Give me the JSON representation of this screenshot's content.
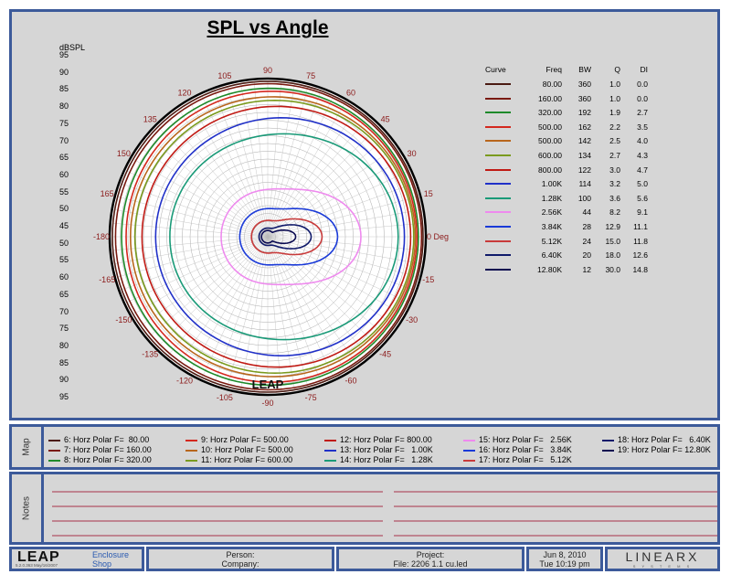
{
  "title": "SPL vs Angle",
  "y_axis_title": "dBSPL",
  "y_axis_labels": [
    "95",
    "90",
    "85",
    "80",
    "75",
    "70",
    "65",
    "60",
    "55",
    "50",
    "45",
    "50",
    "55",
    "60",
    "65",
    "70",
    "75",
    "80",
    "85",
    "90",
    "95"
  ],
  "angle_labels": [
    {
      "text": "90",
      "angle": 90
    },
    {
      "text": "75",
      "angle": 75
    },
    {
      "text": "60",
      "angle": 60
    },
    {
      "text": "45",
      "angle": 45
    },
    {
      "text": "30",
      "angle": 30
    },
    {
      "text": "15",
      "angle": 15
    },
    {
      "text": "0 Deg",
      "angle": 0
    },
    {
      "text": "-15",
      "angle": -15
    },
    {
      "text": "-30",
      "angle": -30
    },
    {
      "text": "-45",
      "angle": -45
    },
    {
      "text": "-60",
      "angle": -60
    },
    {
      "text": "-75",
      "angle": -75
    },
    {
      "text": "-90",
      "angle": -90
    },
    {
      "text": "-105",
      "angle": -105
    },
    {
      "text": "-120",
      "angle": -120
    },
    {
      "text": "-135",
      "angle": -135
    },
    {
      "text": "-150",
      "angle": -150
    },
    {
      "text": "-165",
      "angle": -165
    },
    {
      "text": "-180",
      "angle": 180
    },
    {
      "text": "165",
      "angle": 165
    },
    {
      "text": "150",
      "angle": 150
    },
    {
      "text": "135",
      "angle": 135
    },
    {
      "text": "120",
      "angle": 120
    },
    {
      "text": "105",
      "angle": 105
    }
  ],
  "curve_table": {
    "headers": [
      "Curve",
      "Freq",
      "BW",
      "Q",
      "DI"
    ],
    "rows": [
      {
        "color": "#4b1a12",
        "freq": "80.00",
        "bw": "360",
        "q": "1.0",
        "di": "0.0"
      },
      {
        "color": "#7a1a10",
        "freq": "160.00",
        "bw": "360",
        "q": "1.0",
        "di": "0.0"
      },
      {
        "color": "#1e8a2a",
        "freq": "320.00",
        "bw": "192",
        "q": "1.9",
        "di": "2.7"
      },
      {
        "color": "#d4281e",
        "freq": "500.00",
        "bw": "162",
        "q": "2.2",
        "di": "3.5"
      },
      {
        "color": "#b8661c",
        "freq": "500.00",
        "bw": "142",
        "q": "2.5",
        "di": "4.0"
      },
      {
        "color": "#7a9a1e",
        "freq": "600.00",
        "bw": "134",
        "q": "2.7",
        "di": "4.3"
      },
      {
        "color": "#c01a14",
        "freq": "800.00",
        "bw": "122",
        "q": "3.0",
        "di": "4.7"
      },
      {
        "color": "#2030c8",
        "freq": "1.00K",
        "bw": "114",
        "q": "3.2",
        "di": "5.0"
      },
      {
        "color": "#1a9a78",
        "freq": "1.28K",
        "bw": "100",
        "q": "3.6",
        "di": "5.6"
      },
      {
        "color": "#ee8aee",
        "freq": "2.56K",
        "bw": "44",
        "q": "8.2",
        "di": "9.1"
      },
      {
        "color": "#1a3ad8",
        "freq": "3.84K",
        "bw": "28",
        "q": "12.9",
        "di": "11.1"
      },
      {
        "color": "#c83a3a",
        "freq": "5.12K",
        "bw": "24",
        "q": "15.0",
        "di": "11.8"
      },
      {
        "color": "#101a6a",
        "freq": "6.40K",
        "bw": "20",
        "q": "18.0",
        "di": "12.6"
      },
      {
        "color": "#0a0a50",
        "freq": "12.80K",
        "bw": "12",
        "q": "30.0",
        "di": "14.8"
      }
    ]
  },
  "map": {
    "label": "Map",
    "columns": [
      [
        {
          "color": "#4b1a12",
          "text": "6: Horz Polar F=  80.00"
        },
        {
          "color": "#7a1a10",
          "text": "7: Horz Polar F= 160.00"
        },
        {
          "color": "#1e8a2a",
          "text": "8: Horz Polar F= 320.00"
        }
      ],
      [
        {
          "color": "#d4281e",
          "text": "9: Horz Polar F= 500.00"
        },
        {
          "color": "#b8661c",
          "text": "10: Horz Polar F= 500.00"
        },
        {
          "color": "#7a9a1e",
          "text": "11: Horz Polar F= 600.00"
        }
      ],
      [
        {
          "color": "#c01a14",
          "text": "12: Horz Polar F= 800.00"
        },
        {
          "color": "#2030c8",
          "text": "13: Horz Polar F=   1.00K"
        },
        {
          "color": "#1a9a78",
          "text": "14: Horz Polar F=   1.28K"
        }
      ],
      [
        {
          "color": "#ee8aee",
          "text": "15: Horz Polar F=   2.56K"
        },
        {
          "color": "#1a3ad8",
          "text": "16: Horz Polar F=   3.84K"
        },
        {
          "color": "#c83a3a",
          "text": "17: Horz Polar F=   5.12K"
        }
      ],
      [
        {
          "color": "#101a6a",
          "text": "18: Horz Polar F=   6.40K"
        },
        {
          "color": "#0a0a50",
          "text": "19: Horz Polar F= 12.80K"
        }
      ]
    ]
  },
  "notes": {
    "label": "Notes"
  },
  "footer": {
    "logo": "LEAP",
    "version": "5.2.0.363  May/16/2007",
    "app_line1": "Enclosure",
    "app_line2": "Shop",
    "person_label": "Person:",
    "company_label": "Company:",
    "project_label": "Project:",
    "file_label": "File: 2206 1.1 cu.led",
    "date": "Jun  8, 2010",
    "time": "Tue 10:19 pm",
    "brand": "LINEARX",
    "brand_sub": "S Y S T E M S"
  },
  "colors": {
    "frame_border": "#3c5a9a",
    "panel_bg": "#d6d6d6",
    "angle_label": "#8b1a1a",
    "notes_line": "#a8324a"
  }
}
